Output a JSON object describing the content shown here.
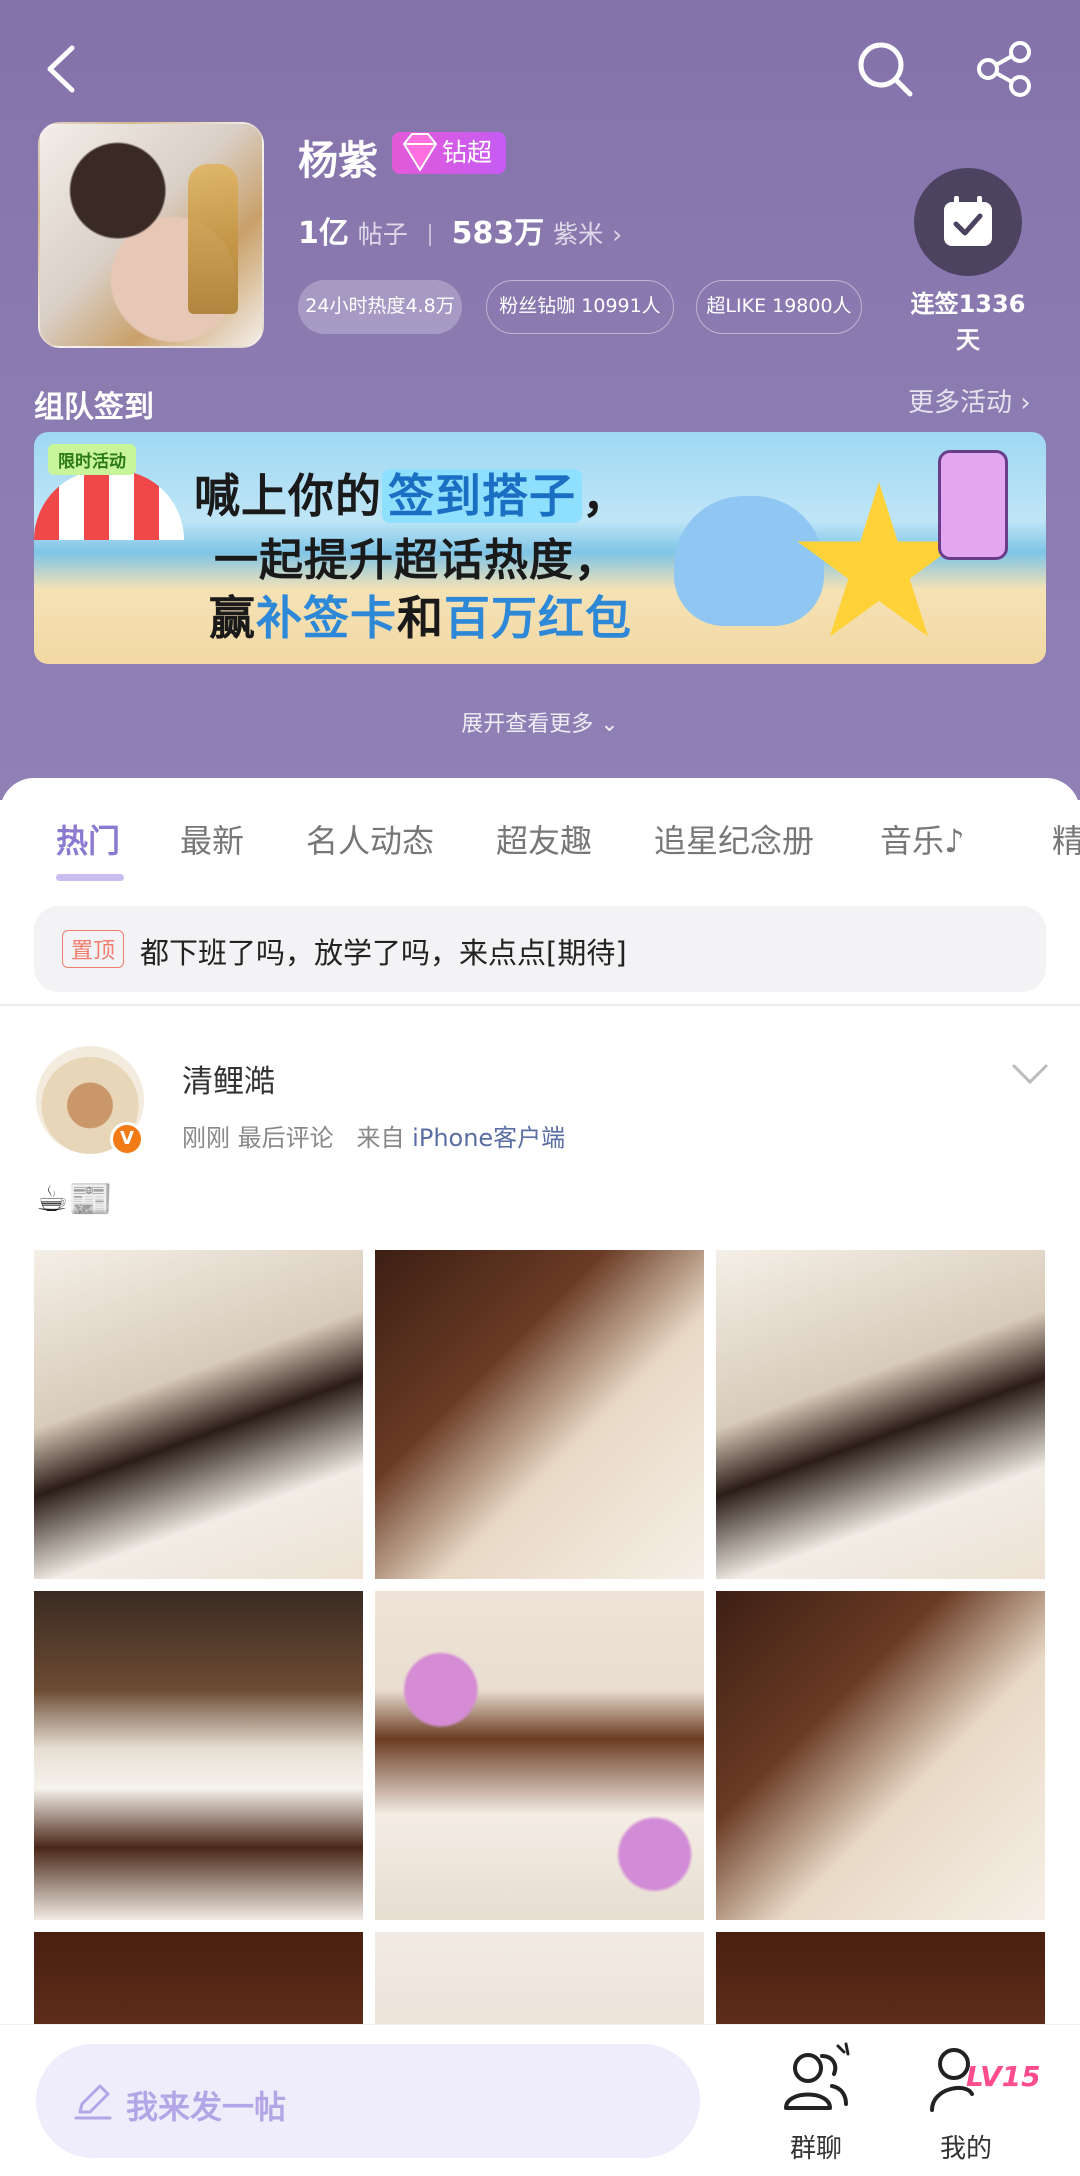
{
  "topbar": {
    "back_icon": "chevron-left-icon",
    "search_icon": "search-icon",
    "share_icon": "share-icon"
  },
  "profile": {
    "name": "杨紫",
    "badge": "钻超",
    "posts_value": "1亿",
    "posts_label": "帖子",
    "fans_value": "583万",
    "fans_label": "紫米",
    "pills": [
      "24小时热度4.8万",
      "粉丝钻咖 10991人",
      "超LIKE 19800人"
    ],
    "checkin_text": "连签1336天"
  },
  "section": {
    "title": "组队签到",
    "more": "更多活动"
  },
  "banner": {
    "tag": "限时活动",
    "line1_pre": "喊上你的",
    "line1_hl": "签到搭子",
    "line1_post": "，",
    "line2": "一起提升超话热度，",
    "line3_a": "赢",
    "line3_hl1": "补签卡",
    "line3_b": "和",
    "line3_hl2": "百万红包"
  },
  "expand_label": "展开查看更多",
  "tabs": [
    "热门",
    "最新",
    "名人动态",
    "超友趣",
    "追星纪念册",
    "音乐",
    "精"
  ],
  "pinned": {
    "tag": "置顶",
    "text": "都下班了吗，放学了吗，来点点[期待]"
  },
  "post": {
    "username": "清鲤澔",
    "time": "刚刚 最后评论",
    "source_prefix": "来自",
    "device": "iPhone客户端",
    "emoji": "☕📰",
    "verified": "V"
  },
  "bottom": {
    "compose_placeholder": "我来发一帖",
    "group_chat": "群聊",
    "mine": "我的",
    "level": "LV15"
  },
  "colors": {
    "header_bg": "#8b7cb2",
    "accent": "#8b7ad0",
    "pin": "#f27d6f",
    "level": "#ff4d8d"
  }
}
